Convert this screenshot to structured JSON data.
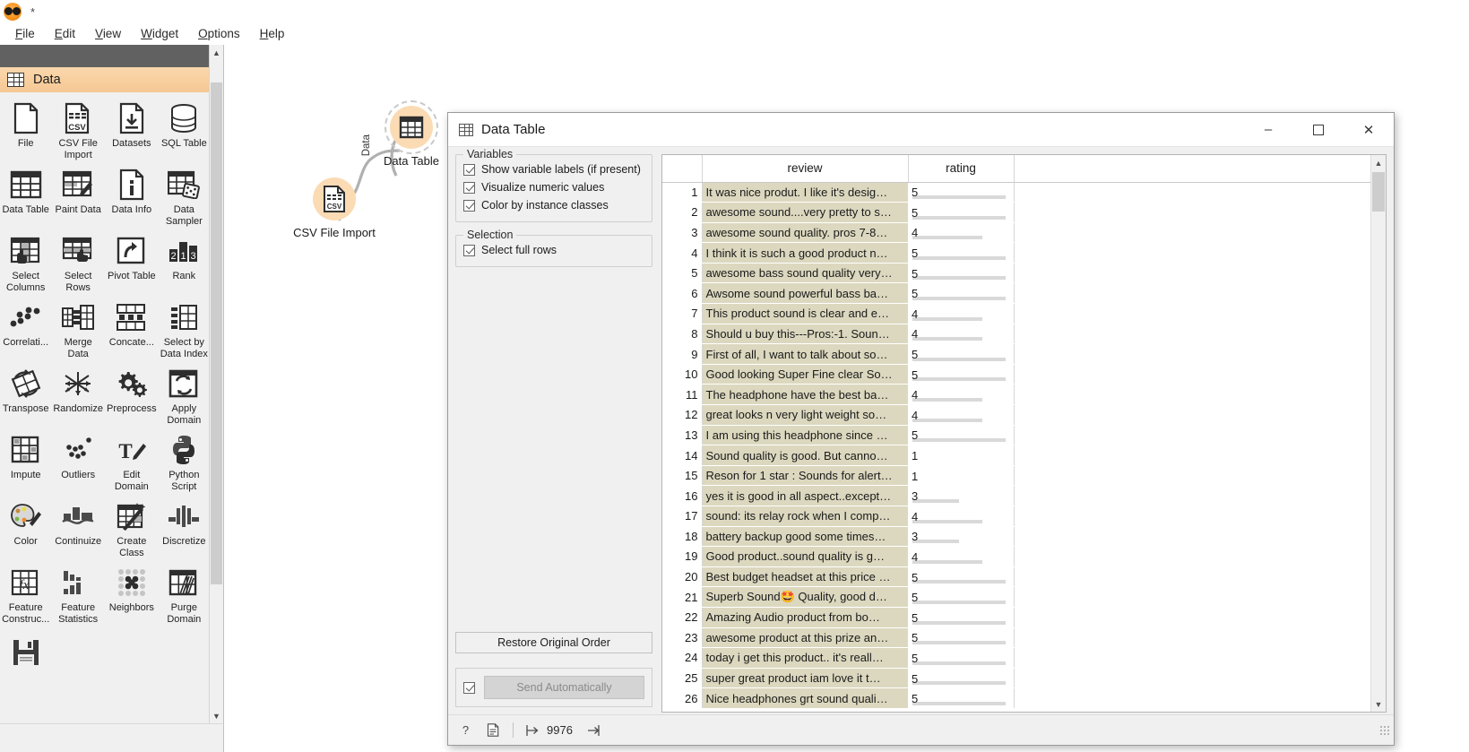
{
  "app": {
    "modified_marker": "*",
    "logo_name": "orange-logo-icon"
  },
  "menubar": [
    {
      "label": "File",
      "mnemonic": "F"
    },
    {
      "label": "Edit",
      "mnemonic": "E"
    },
    {
      "label": "View",
      "mnemonic": "V"
    },
    {
      "label": "Widget",
      "mnemonic": "W"
    },
    {
      "label": "Options",
      "mnemonic": "O"
    },
    {
      "label": "Help",
      "mnemonic": "H"
    }
  ],
  "dock": {
    "collapse_glyph": "«",
    "category": "Data",
    "widgets": [
      {
        "label": "File",
        "icon": "file-icon"
      },
      {
        "label": "CSV File Import",
        "icon": "csv-file-icon"
      },
      {
        "label": "Datasets",
        "icon": "datasets-download-icon"
      },
      {
        "label": "SQL Table",
        "icon": "sql-database-icon"
      },
      {
        "label": "Data Table",
        "icon": "data-table-icon"
      },
      {
        "label": "Paint Data",
        "icon": "paint-brush-icon"
      },
      {
        "label": "Data Info",
        "icon": "info-document-icon"
      },
      {
        "label": "Data Sampler",
        "icon": "dice-table-icon"
      },
      {
        "label": "Select Columns",
        "icon": "select-columns-icon"
      },
      {
        "label": "Select Rows",
        "icon": "select-rows-icon"
      },
      {
        "label": "Pivot Table",
        "icon": "pivot-arrow-icon"
      },
      {
        "label": "Rank",
        "icon": "rank-bars-icon"
      },
      {
        "label": "Correlati...",
        "icon": "correlation-dots-icon"
      },
      {
        "label": "Merge Data",
        "icon": "merge-data-icon"
      },
      {
        "label": "Concate...",
        "icon": "concatenate-icon"
      },
      {
        "label": "Select by Data Index",
        "icon": "select-by-index-icon"
      },
      {
        "label": "Transpose",
        "icon": "transpose-icon"
      },
      {
        "label": "Randomize",
        "icon": "randomize-arrows-icon"
      },
      {
        "label": "Preprocess",
        "icon": "gears-icon"
      },
      {
        "label": "Apply Domain",
        "icon": "apply-domain-icon"
      },
      {
        "label": "Impute",
        "icon": "impute-grid-icon"
      },
      {
        "label": "Outliers",
        "icon": "outliers-dots-icon"
      },
      {
        "label": "Edit Domain",
        "icon": "edit-domain-pencil-icon"
      },
      {
        "label": "Python Script",
        "icon": "python-icon"
      },
      {
        "label": "Color",
        "icon": "color-palette-icon"
      },
      {
        "label": "Continuize",
        "icon": "continuize-icon"
      },
      {
        "label": "Create Class",
        "icon": "create-class-wand-icon"
      },
      {
        "label": "Discretize",
        "icon": "discretize-icon"
      },
      {
        "label": "Feature Construc...",
        "icon": "feature-construct-fx-icon"
      },
      {
        "label": "Feature Statistics",
        "icon": "feature-statistics-icon"
      },
      {
        "label": "Neighbors",
        "icon": "neighbors-dots-icon"
      },
      {
        "label": "Purge Domain",
        "icon": "purge-domain-icon"
      }
    ],
    "save_icon": "save-floppy-icon"
  },
  "canvas": {
    "nodes": [
      {
        "label": "CSV File Import",
        "icon": "csv-file-icon"
      },
      {
        "label": "Data Table",
        "icon": "data-table-icon"
      }
    ],
    "link_label": "Data"
  },
  "dialog": {
    "title": "Data Table",
    "title_icon": "data-table-icon",
    "window_buttons": {
      "minimize": "–",
      "maximize": "☐",
      "close": "✕"
    },
    "variables_group": {
      "title": "Variables",
      "options": [
        {
          "label": "Show variable labels (if present)",
          "checked": true
        },
        {
          "label": "Visualize numeric values",
          "checked": true
        },
        {
          "label": "Color by instance classes",
          "checked": true
        }
      ]
    },
    "selection_group": {
      "title": "Selection",
      "options": [
        {
          "label": "Select full rows",
          "checked": true
        }
      ]
    },
    "restore_button": "Restore Original Order",
    "send_auto": {
      "label": "Send Automatically",
      "checked": true
    },
    "status": {
      "help_icon": "help-question-icon",
      "report_icon": "report-document-icon",
      "input_icon": "input-arrow-icon",
      "input_count": "9976",
      "output_icon": "output-arrow-icon"
    },
    "table": {
      "columns": [
        "review",
        "rating"
      ],
      "rating_max": 5,
      "rows": [
        {
          "index": "1",
          "review": "It was nice produt. I like it's desig…",
          "rating": "5"
        },
        {
          "index": "2",
          "review": "awesome sound....very pretty to s…",
          "rating": "5"
        },
        {
          "index": "3",
          "review": "awesome sound quality. pros 7-8…",
          "rating": "4"
        },
        {
          "index": "4",
          "review": "I think it is such a good product n…",
          "rating": "5"
        },
        {
          "index": "5",
          "review": "awesome bass sound quality very…",
          "rating": "5"
        },
        {
          "index": "6",
          "review": "Awsome sound powerful bass ba…",
          "rating": "5"
        },
        {
          "index": "7",
          "review": "This product sound is clear and e…",
          "rating": "4"
        },
        {
          "index": "8",
          "review": "Should u buy this---Pros:-1. Soun…",
          "rating": "4"
        },
        {
          "index": "9",
          "review": "First of all, I want to talk about so…",
          "rating": "5"
        },
        {
          "index": "10",
          "review": "Good looking Super Fine clear So…",
          "rating": "5"
        },
        {
          "index": "11",
          "review": "The headphone have the best ba…",
          "rating": "4"
        },
        {
          "index": "12",
          "review": "great looks n very light weight so…",
          "rating": "4"
        },
        {
          "index": "13",
          "review": "I am using this headphone since …",
          "rating": "5"
        },
        {
          "index": "14",
          "review": "Sound quality is good. But canno…",
          "rating": "1"
        },
        {
          "index": "15",
          "review": "Reson for 1 star : Sounds for alert…",
          "rating": "1"
        },
        {
          "index": "16",
          "review": "yes it is good in all aspect..except…",
          "rating": "3"
        },
        {
          "index": "17",
          "review": "sound: its relay rock when I comp…",
          "rating": "4"
        },
        {
          "index": "18",
          "review": "battery backup good some times…",
          "rating": "3"
        },
        {
          "index": "19",
          "review": "Good product..sound quality is g…",
          "rating": "4"
        },
        {
          "index": "20",
          "review": "Best budget headset at this price …",
          "rating": "5"
        },
        {
          "index": "21",
          "review": "Superb Sound🤩 Quality, good d…",
          "rating": "5"
        },
        {
          "index": "22",
          "review": "Amazing Audio product from bo…",
          "rating": "5"
        },
        {
          "index": "23",
          "review": "awesome product at this prize an…",
          "rating": "5"
        },
        {
          "index": "24",
          "review": "today i get this product.. it's reall…",
          "rating": "5"
        },
        {
          "index": "25",
          "review": "super great product iam love it t…",
          "rating": "5"
        },
        {
          "index": "26",
          "review": "Nice headphones grt sound quali…",
          "rating": "5"
        }
      ]
    }
  },
  "colors": {
    "accent_orange": "#f5931e",
    "node_fill": "#fbdbb4",
    "category_header": "#f5c894",
    "selected_cell": "#dcd8bf",
    "bar_gray": "#d9d9d9"
  }
}
